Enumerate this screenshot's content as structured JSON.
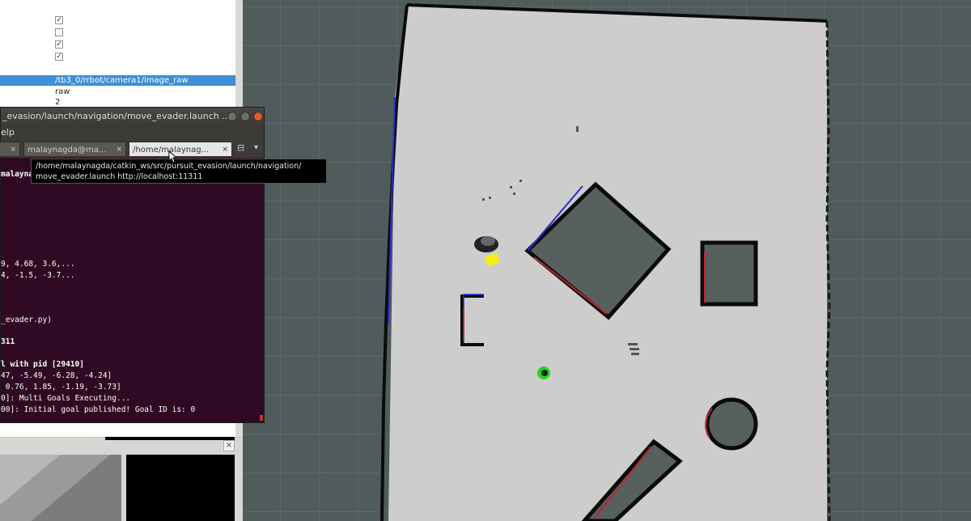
{
  "rviz_panel": {
    "checkboxes": [
      {
        "checked": true,
        "glyph": "✓"
      },
      {
        "checked": false,
        "glyph": ""
      },
      {
        "checked": true,
        "glyph": "✓"
      },
      {
        "checked": true,
        "glyph": "✓"
      }
    ],
    "image_topic": "/tb3_0/rrbot/camera1/image_raw",
    "transport": "raw",
    "queue_value": "2"
  },
  "terminal": {
    "title": "_evasion/launch/navigation/move_evader.launch ...",
    "menu_partial": "elp",
    "tabs": [
      {
        "label": "",
        "close": "×"
      },
      {
        "label": "malaynagda@ma...",
        "close": "×"
      },
      {
        "label": "/home/malaynag...",
        "close": "×"
      }
    ],
    "new_tab_glyph": "⊟",
    "menu_glyph": "▾",
    "lines": [
      "malaynag",
      "",
      "",
      "",
      "",
      "",
      "9, 4.68, 3.6,...",
      "4, -1.5, -3.7...",
      "",
      "",
      "_evader.py)",
      "",
      "311",
      "",
      "l with pid [29410]",
      "47, -5.49, -6.28, -4.24]",
      " 0.76, 1.85, -1.19, -3.73]",
      "0]: Multi Goals Executing...",
      "00]: Initial goal published! Goal ID is: 0"
    ]
  },
  "tooltip": {
    "line1": "/home/malaynagda/catkin_ws/src/pursuit_evasion/launch/navigation/",
    "line2": "move_evader.launch http://localhost:11311"
  },
  "image_view": {
    "close_glyph": "×"
  }
}
